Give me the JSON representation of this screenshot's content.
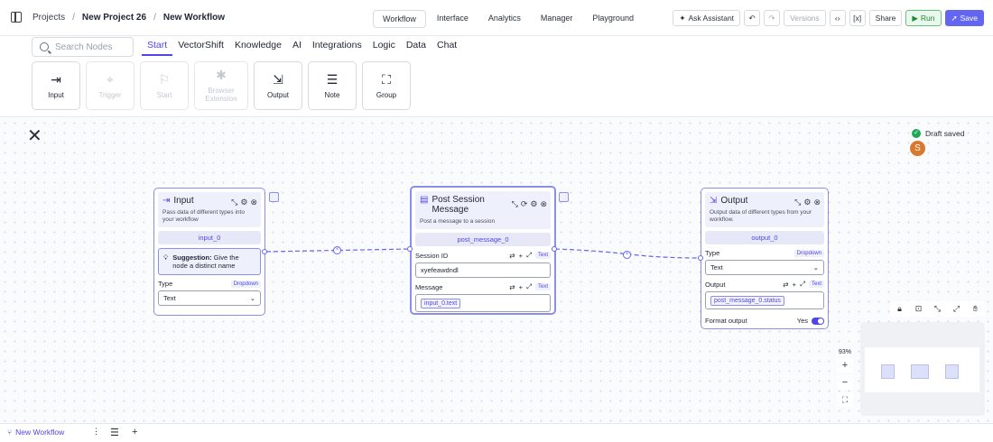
{
  "header": {
    "breadcrumb": [
      "Projects",
      "New Project 26",
      "New Workflow"
    ],
    "tabs": [
      "Workflow",
      "Interface",
      "Analytics",
      "Manager",
      "Playground"
    ],
    "active_tab": "Workflow",
    "ask_assistant": "Ask Assistant",
    "versions": "Versions",
    "share": "Share",
    "run": "Run",
    "save": "Save"
  },
  "toolbar": {
    "search_placeholder": "Search Nodes",
    "categories": [
      "Start",
      "VectorShift",
      "Knowledge",
      "AI",
      "Integrations",
      "Logic",
      "Data",
      "Chat"
    ],
    "active_category": "Start",
    "tiles": [
      {
        "label": "Input",
        "icon": "input-icon",
        "enabled": true
      },
      {
        "label": "Trigger",
        "icon": "trigger-icon",
        "enabled": false
      },
      {
        "label": "Start",
        "icon": "flag-icon",
        "enabled": false
      },
      {
        "label": "Browser Extension",
        "icon": "puzzle-icon",
        "enabled": false
      },
      {
        "label": "Output",
        "icon": "output-icon",
        "enabled": true
      },
      {
        "label": "Note",
        "icon": "note-icon",
        "enabled": true
      },
      {
        "label": "Group",
        "icon": "group-icon",
        "enabled": true
      }
    ]
  },
  "canvas": {
    "draft_status": "Draft saved",
    "avatar_initial": "S",
    "zoom": "93%"
  },
  "nodes": {
    "input": {
      "title": "Input",
      "description": "Pass data of different types into your workflow",
      "name": "input_0",
      "suggestion_label": "Suggestion:",
      "suggestion_text": "Give the node a distinct name",
      "type_label": "Type",
      "type_badge": "Dropdown",
      "type_value": "Text"
    },
    "post": {
      "title": "Post Session Message",
      "description": "Post a message to a session",
      "name": "post_message_0",
      "session_label": "Session ID",
      "session_badge": "Text",
      "session_value": "xyefeawdndl",
      "message_label": "Message",
      "message_badge": "Text",
      "message_token": "input_0.text"
    },
    "output": {
      "title": "Output",
      "description": "Output data of different types from your workflow.",
      "name": "output_0",
      "type_label": "Type",
      "type_badge": "Dropdown",
      "type_value": "Text",
      "output_label": "Output",
      "output_badge": "Text",
      "output_token": "post_message_0.status",
      "format_label": "Format output",
      "format_value": "Yes"
    }
  },
  "bottom": {
    "workflow_tab": "New Workflow"
  },
  "colors": {
    "accent": "#4f46e5",
    "node_border": "#8b8fe8",
    "run_green": "#1e8a34",
    "avatar": "#d9782f"
  }
}
